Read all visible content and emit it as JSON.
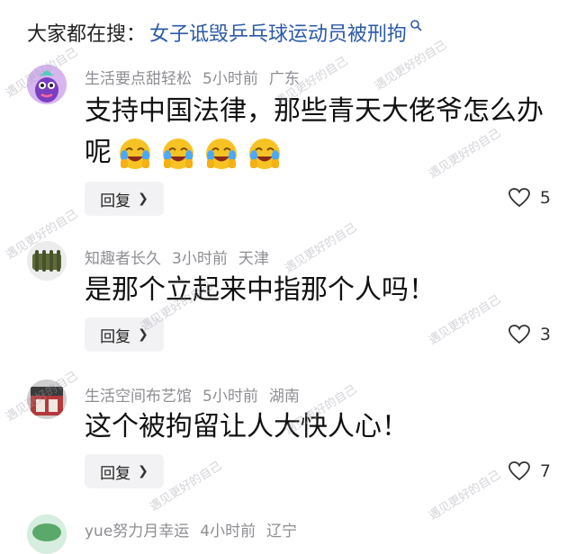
{
  "search": {
    "prefix": "大家都在搜：",
    "topic": "女子诋毁乒乓球运动员被刑拘",
    "icon": "search-icon"
  },
  "watermark": "遇见更好的自己",
  "comments": [
    {
      "username": "生活要点甜轻松",
      "time": "5小时前",
      "location": "广东",
      "text": "支持中国法律，那些青天大佬爷怎么办呢",
      "emojis": [
        "crying-laughing-emoji",
        "crying-laughing-emoji",
        "crying-laughing-emoji",
        "crying-laughing-emoji"
      ],
      "reply_label": "回复",
      "likes": "5"
    },
    {
      "username": "知趣者长久",
      "time": "3小时前",
      "location": "天津",
      "text": "是那个立起来中指那个人吗！",
      "reply_label": "回复",
      "likes": "3"
    },
    {
      "username": "生活空间布艺馆",
      "time": "5小时前",
      "location": "湖南",
      "text": "这个被拘留让人大快人心！",
      "reply_label": "回复",
      "likes": "7"
    },
    {
      "username": "yue努力月幸运",
      "time": "4小时前",
      "location": "辽宁"
    }
  ]
}
